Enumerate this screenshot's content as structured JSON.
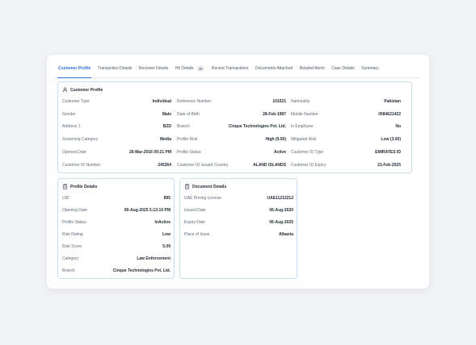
{
  "tabs": [
    {
      "label": "Customer Profile",
      "active": true
    },
    {
      "label": "Transaction Details"
    },
    {
      "label": "Receiver Details"
    },
    {
      "label": "Hit Details",
      "badge": "35"
    },
    {
      "label": "Recent Transactions"
    },
    {
      "label": "Documents Attached"
    },
    {
      "label": "Related Alerts"
    },
    {
      "label": "Case Details"
    },
    {
      "label": "Summary"
    }
  ],
  "customer_profile": {
    "title": "Customer Profile",
    "icon": "user-icon",
    "columns": [
      [
        {
          "label": "Customer Type",
          "value": "Individual"
        },
        {
          "label": "Gender",
          "value": "Male"
        },
        {
          "label": "Address 1",
          "value": "BZD"
        },
        {
          "label": "Screening Category",
          "value": "Media"
        },
        {
          "label": "Opened Date",
          "value": "26-Mar-2016 09:21 PM"
        },
        {
          "label": "Customer ID Number",
          "value": "245364"
        }
      ],
      [
        {
          "label": "Reference Number",
          "value": "101521"
        },
        {
          "label": "Date of Birth",
          "value": "28-Feb-1987"
        },
        {
          "label": "Branch",
          "value": "Cinque Technologies Pvt. Ltd."
        },
        {
          "label": "Profile Risk",
          "value": "High (9.50)"
        },
        {
          "label": "Profile Status",
          "value": "Active"
        },
        {
          "label": "Customer ID Issued Country",
          "value": "ALAND ISLANDS"
        }
      ],
      [
        {
          "label": "Nationality",
          "value": "Pakistan"
        },
        {
          "label": "Mobile Number",
          "value": "0584621422"
        },
        {
          "label": "Is Employee",
          "value": "No"
        },
        {
          "label": "Mitigated Risk",
          "value": "Low (3.00)"
        },
        {
          "label": "Customer ID Type",
          "value": "EMIRATES ID"
        },
        {
          "label": "Customer ID Expiry",
          "value": "21-Feb-2025"
        }
      ]
    ]
  },
  "profile_details": {
    "title": "Profile Details",
    "icon": "clipboard-icon",
    "rows": [
      {
        "label": "UID",
        "value": "895"
      },
      {
        "label": "Opening Date",
        "value": "06-Aug-2025 5:13:10 PM"
      },
      {
        "label": "Profile Status",
        "value": "InActive"
      },
      {
        "label": "Risk Rating",
        "value": "Low"
      },
      {
        "label": "Risk Score",
        "value": "5.09"
      },
      {
        "label": "Category",
        "value": "Law Enforcement"
      },
      {
        "label": "Branch",
        "value": "Cinque Technologies Pvt. Ltd."
      }
    ]
  },
  "document_details": {
    "title": "Document Details",
    "icon": "document-icon",
    "rows": [
      {
        "label": "UAE Driving License",
        "value": "UAE11212212"
      },
      {
        "label": "Issued Date",
        "value": "06-Aug-2020"
      },
      {
        "label": "Expiry Date",
        "value": "06-Aug-2025"
      },
      {
        "label": "Place of Issue",
        "value": "Albania"
      }
    ]
  },
  "colors": {
    "accent": "#2f6fe0",
    "panel_border": "#c9dcf4",
    "background": "#f1f3f6"
  }
}
